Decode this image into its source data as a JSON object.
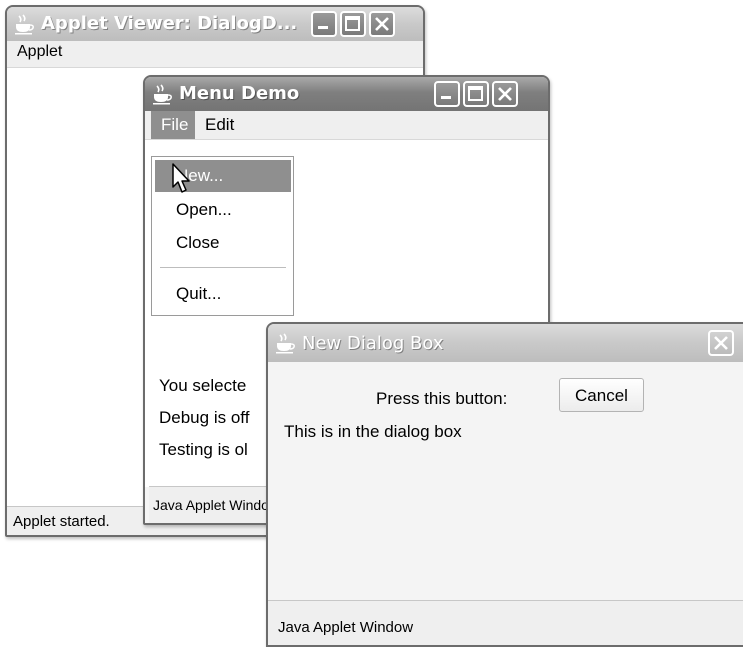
{
  "applet_viewer": {
    "title": "Applet Viewer: DialogD...",
    "menu_label": "Applet",
    "status": "Applet started."
  },
  "menu_demo": {
    "title": "Menu Demo",
    "menus": [
      "File",
      "Edit"
    ],
    "file_menu_items": [
      "New...",
      "Open...",
      "Close",
      "Quit..."
    ],
    "highlighted_item": "New...",
    "lines": [
      "You selecte",
      "Debug is off",
      "Testing is ol"
    ],
    "status": "Java Applet Window"
  },
  "dialog": {
    "title": "New Dialog Box",
    "prompt": "Press this button:",
    "button_label": "Cancel",
    "message": "This is in the dialog box",
    "status": "Java Applet Window"
  },
  "icons": {
    "window": "java-cup-icon",
    "minimize": "minimize-icon",
    "maximize": "maximize-icon",
    "close": "close-icon",
    "cursor": "mouse-pointer-icon"
  },
  "colors": {
    "titlebar_active": "#7f7f7f",
    "titlebar_inactive": "#c9c9c9",
    "menu_highlight": "#8f8f8f",
    "window_bg": "#f4f4f4"
  }
}
